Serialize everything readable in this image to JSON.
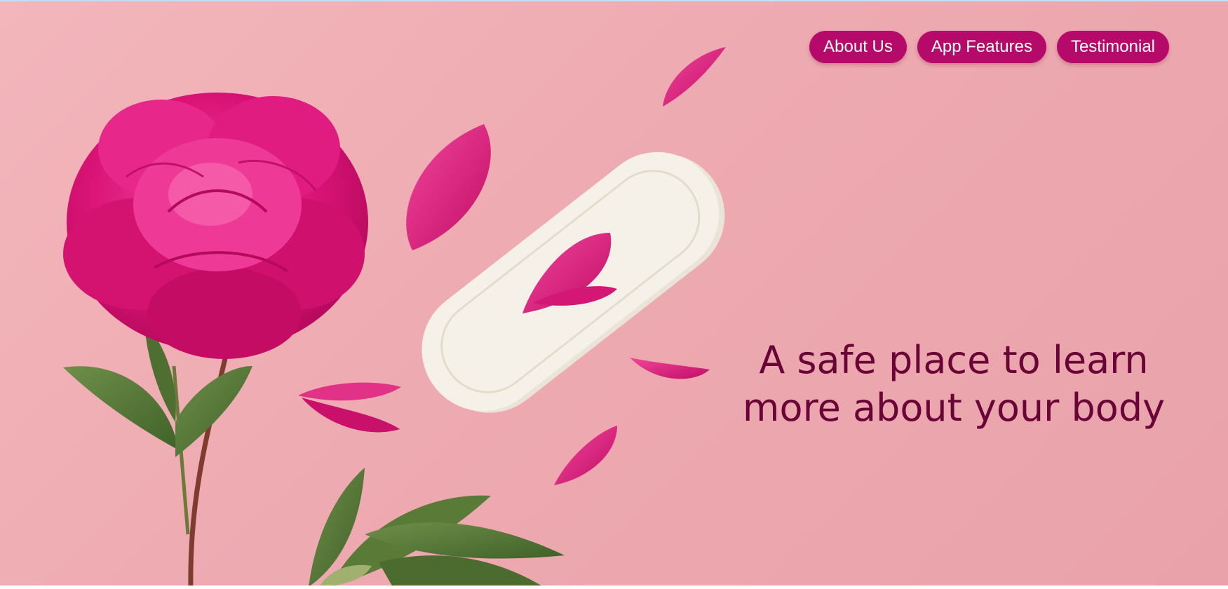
{
  "colors": {
    "background": "#eeabb2",
    "button_fill": "#b60a6b",
    "button_text": "#ffffff",
    "headline": "#6a0438"
  },
  "nav": {
    "items": [
      {
        "label": "About Us"
      },
      {
        "label": "App Features"
      },
      {
        "label": "Testimonial"
      }
    ]
  },
  "hero": {
    "headline_line1": "A safe place to learn",
    "headline_line2": "more about your body"
  }
}
